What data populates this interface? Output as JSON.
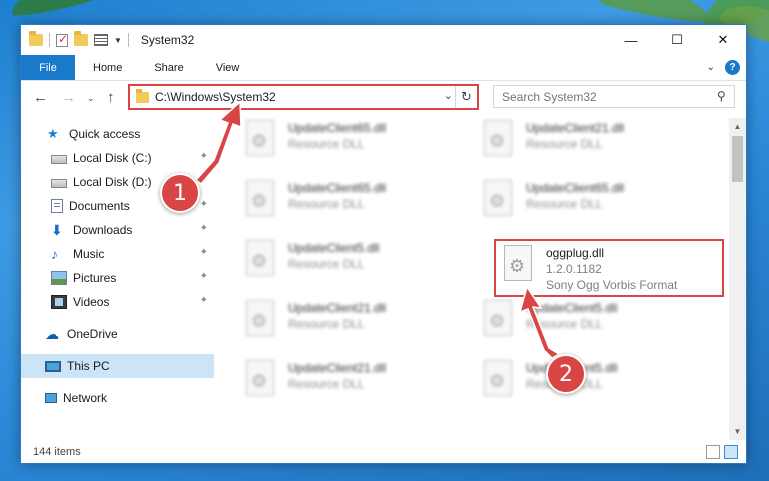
{
  "window": {
    "title": "System32",
    "controls": {
      "minimize": "—",
      "maximize": "☐",
      "close": "✕"
    }
  },
  "ribbon": {
    "tabs": [
      "File",
      "Home",
      "Share",
      "View"
    ]
  },
  "address": {
    "path": "C:\\Windows\\System32",
    "search_placeholder": "Search System32"
  },
  "sidebar": {
    "items": [
      {
        "label": "Quick access",
        "icon": "star-icon",
        "pinned": false
      },
      {
        "label": "Local Disk (C:)",
        "icon": "disk-icon",
        "pinned": true
      },
      {
        "label": "Local Disk (D:)",
        "icon": "disk-icon",
        "pinned": true
      },
      {
        "label": "Documents",
        "icon": "documents-icon",
        "pinned": true
      },
      {
        "label": "Downloads",
        "icon": "download-icon",
        "pinned": true
      },
      {
        "label": "Music",
        "icon": "music-icon",
        "pinned": true
      },
      {
        "label": "Pictures",
        "icon": "pictures-icon",
        "pinned": true
      },
      {
        "label": "Videos",
        "icon": "videos-icon",
        "pinned": true
      },
      {
        "label": "OneDrive",
        "icon": "cloud-icon",
        "pinned": false
      },
      {
        "label": "This PC",
        "icon": "pc-icon",
        "pinned": false,
        "selected": true
      },
      {
        "label": "Network",
        "icon": "network-icon",
        "pinned": false
      }
    ]
  },
  "files": [
    {
      "name": "UpdateClient65.dll",
      "sub": "Resource DLL",
      "blurred": true
    },
    {
      "name": "UpdateClient21.dll",
      "sub": "Resource DLL",
      "blurred": true
    },
    {
      "name": "UpdateClient65.dll",
      "sub": "Resource DLL",
      "blurred": true
    },
    {
      "name": "UpdateClient65.dll",
      "sub": "Resource DLL",
      "blurred": true
    },
    {
      "name": "UpdateClient5.dll",
      "sub": "Resource DLL",
      "blurred": true
    },
    {
      "name": "oggplug.dll",
      "sub": "1.2.0.1182",
      "desc": "Sony Ogg Vorbis Format",
      "blurred": false,
      "highlighted": true
    },
    {
      "name": "UpdateClient21.dll",
      "sub": "Resource DLL",
      "blurred": true
    },
    {
      "name": "UpdateClient5.dll",
      "sub": "Resource DLL",
      "blurred": true
    },
    {
      "name": "UpdateClient21.dll",
      "sub": "Resource DLL",
      "blurred": true
    },
    {
      "name": "UpdateClient5.dll",
      "sub": "Resource DLL",
      "blurred": true
    }
  ],
  "status": {
    "item_count": "144 items"
  },
  "annotations": [
    {
      "number": "1"
    },
    {
      "number": "2"
    }
  ],
  "colors": {
    "accent": "#1979ca",
    "highlight": "#d94444",
    "selected": "#cce4f7"
  }
}
